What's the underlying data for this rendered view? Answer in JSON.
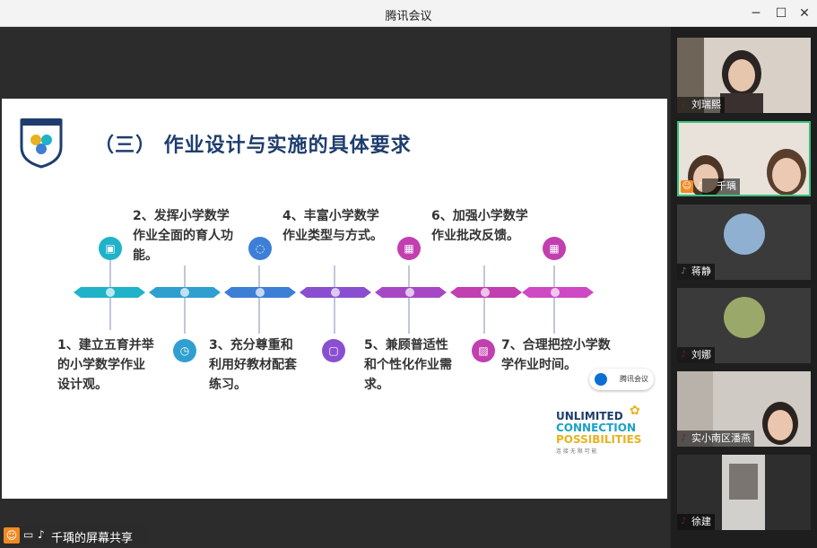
{
  "window": {
    "title": "腾讯会议",
    "min_icon": "minimize-icon",
    "max_icon": "maximize-icon",
    "close_icon": "close-icon"
  },
  "slide": {
    "title": "（三） 作业设计与实施的具体要求",
    "steps_top": [
      {
        "line1": "2、发挥小学数学",
        "line2": "作业全面的育人功",
        "line3": "能。"
      },
      {
        "line1": "4、丰富小学数学",
        "line2": "作业类型与方式。"
      },
      {
        "line1": "6、加强小学数学",
        "line2": "作业批改反馈。"
      }
    ],
    "steps_bottom": [
      {
        "line1": "1、建立五育并举",
        "line2": "的小学数学作业",
        "line3": "设计观。"
      },
      {
        "line1": "3、充分尊重和",
        "line2": "利用好教材配套",
        "line3": "练习。"
      },
      {
        "line1": "5、兼顾普适性",
        "line2": "和个性化作业需",
        "line3": "求。"
      },
      {
        "line1": "7、合理把控小学数",
        "line2": "学作业时间。"
      }
    ],
    "brand": {
      "l1": "UNLIMITED",
      "l2": "CONNECTION",
      "l3": "POSSIBILITIES",
      "l4": "连 接 无 限 可 能"
    },
    "float_label": "腾讯会议",
    "colors": {
      "teal": "#1fb3c9",
      "blue": "#3d7fd6",
      "purple": "#8a4fd1",
      "magenta": "#c23fb0",
      "pink": "#e24b9c"
    }
  },
  "share_bar": {
    "text": "千瑀的屏幕共享"
  },
  "participants": [
    {
      "name": "刘瑞熙",
      "muted": true
    },
    {
      "name": "千瑀",
      "muted": false,
      "active": true
    },
    {
      "name": "蒋静",
      "muted": false
    },
    {
      "name": "刘娜",
      "muted": true
    },
    {
      "name": "实小南区潘燕",
      "muted": true
    },
    {
      "name": "徐建",
      "muted": true
    }
  ]
}
